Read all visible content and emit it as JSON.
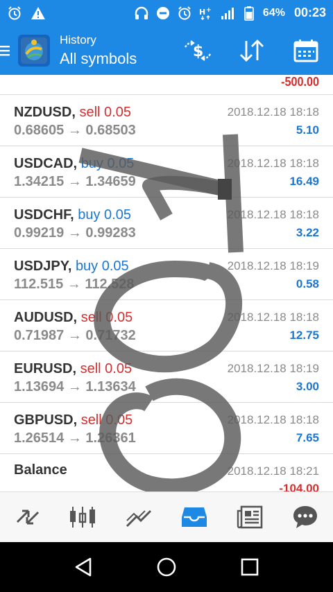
{
  "status_bar": {
    "battery_percent": "64%",
    "time": "00:23",
    "icons": [
      "alarm-icon",
      "warning-icon",
      "headset-icon",
      "dnd-icon",
      "alarm-icon",
      "h-plus-icon",
      "signal-icon",
      "battery-icon"
    ]
  },
  "app_bar": {
    "subtitle": "History",
    "title": "All symbols",
    "actions": [
      "currency-exchange-icon",
      "sort-icon",
      "calendar-icon"
    ],
    "brand_color": "#1e88e5"
  },
  "top_partial": {
    "profit": "-500.00"
  },
  "trades": [
    {
      "symbol": "NZDUSD,",
      "type": "sell",
      "volume": "0.05",
      "open": "0.68605",
      "arrow": "→",
      "close": "0.68503",
      "time": "2018.12.18 18:18",
      "profit": "5.10"
    },
    {
      "symbol": "USDCAD,",
      "type": "buy",
      "volume": "0.05",
      "open": "1.34215",
      "arrow": "→",
      "close": "1.34659",
      "time": "2018.12.18 18:18",
      "profit": "16.49"
    },
    {
      "symbol": "USDCHF,",
      "type": "buy",
      "volume": "0.05",
      "open": "0.99219",
      "arrow": "→",
      "close": "0.99283",
      "time": "2018.12.18 18:18",
      "profit": "3.22"
    },
    {
      "symbol": "USDJPY,",
      "type": "buy",
      "volume": "0.05",
      "open": "112.515",
      "arrow": "→",
      "close": "112.528",
      "time": "2018.12.18 18:19",
      "profit": "0.58"
    },
    {
      "symbol": "AUDUSD,",
      "type": "sell",
      "volume": "0.05",
      "open": "0.71987",
      "arrow": "→",
      "close": "0.71732",
      "time": "2018.12.18 18:18",
      "profit": "12.75"
    },
    {
      "symbol": "EURUSD,",
      "type": "sell",
      "volume": "0.05",
      "open": "1.13694",
      "arrow": "→",
      "close": "1.13634",
      "time": "2018.12.18 18:19",
      "profit": "3.00"
    },
    {
      "symbol": "GBPUSD,",
      "type": "sell",
      "volume": "0.05",
      "open": "1.26514",
      "arrow": "→",
      "close": "1.26361",
      "time": "2018.12.18 18:18",
      "profit": "7.65"
    }
  ],
  "balance_row": {
    "label": "Balance",
    "time": "2018.12.18 18:21",
    "profit": "-104.00"
  },
  "bottom_nav": {
    "items": [
      "quotes-icon",
      "chart-icon",
      "trade-icon",
      "history-icon",
      "news-icon",
      "chat-icon"
    ],
    "active": "history-icon",
    "active_color": "#1e88e5"
  },
  "system_nav": [
    "back-icon",
    "home-icon",
    "recents-icon"
  ]
}
